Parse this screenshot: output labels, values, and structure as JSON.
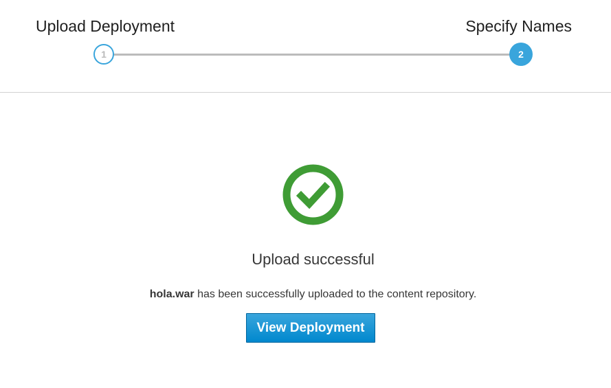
{
  "wizard": {
    "steps": [
      {
        "number": "1",
        "label": "Upload Deployment"
      },
      {
        "number": "2",
        "label": "Specify Names"
      }
    ],
    "active_step": 2
  },
  "result": {
    "icon": "check-circle-icon",
    "title": "Upload successful",
    "filename": "hola.war",
    "message": " has been successfully uploaded to the content repository.",
    "button_label": "View Deployment"
  },
  "colors": {
    "accent": "#39a5dc",
    "success": "#3f9c35",
    "button": "#0088ce"
  }
}
